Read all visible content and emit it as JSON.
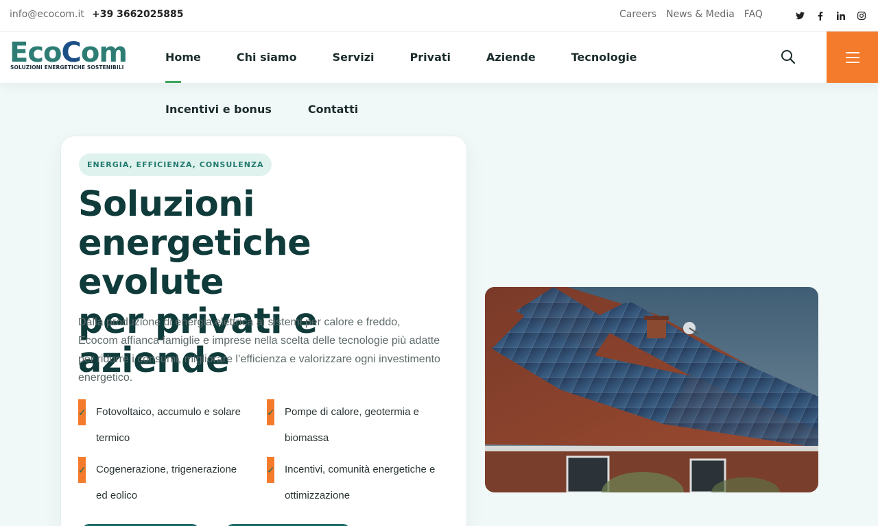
{
  "topbar": {
    "email": "info@ecocom.it",
    "phone": "+39 3662025885",
    "links": [
      "Careers",
      "News & Media",
      "FAQ"
    ],
    "social": [
      "twitter-icon",
      "facebook-icon",
      "linkedin-icon",
      "instagram-icon"
    ]
  },
  "logo": {
    "text_a": "Ec",
    "text_b": "o",
    "text_c": "C",
    "text_d": "om",
    "tagline": "SOLUZIONI ENERGETICHE SOSTENIBILI"
  },
  "nav": {
    "items": [
      "Home",
      "Chi siamo",
      "Servizi",
      "Privati",
      "Aziende",
      "Tecnologie"
    ],
    "items_row2": [
      "Incentivi e bonus",
      "Contatti"
    ],
    "active": "Home"
  },
  "hero": {
    "badge": "ENERGIA, EFFICIENZA, CONSULENZA",
    "title_line1": "Soluzioni",
    "title_line2": "energetiche evolute",
    "title_line3": "per privati e aziende",
    "description": "Dalla produzione di energia elettrica ai sistemi per calore e freddo, Ecocom affianca famiglie e imprese nella scelta delle tecnologie più adatte per ridurre i consumi, migliorare l’efficienza e valorizzare ogni investimento energetico.",
    "features": [
      "Fotovoltaico, accumulo e solare termico",
      "Pompe di calore, geotermia e biomassa",
      "Cogenerazione, trigenerazione ed eolico",
      "Incentivi, comunità energetiche e ottimizzazione"
    ]
  },
  "colors": {
    "accent_orange": "#f47b2c",
    "brand_teal": "#0f3b3a",
    "active_green": "#3aa55b",
    "badge_bg": "#dff2ee"
  }
}
